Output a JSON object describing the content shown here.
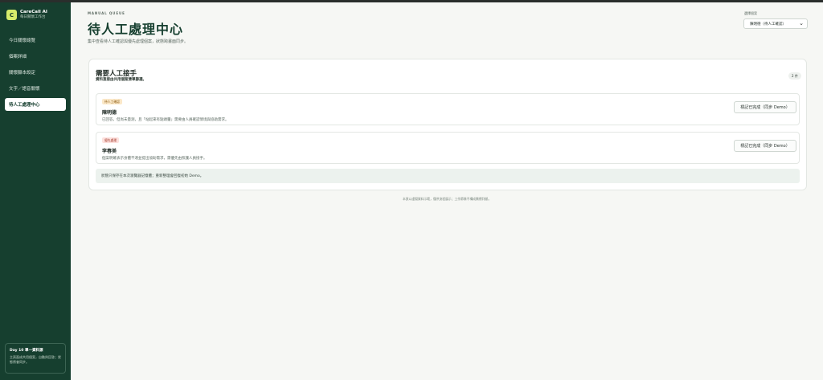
{
  "brand": {
    "logo_letter": "C",
    "name": "CareCall AI",
    "subtitle": "每日關懷工作台"
  },
  "sidebar": {
    "items": [
      {
        "label": "今日關懷總覽",
        "active": false
      },
      {
        "label": "個案詳細",
        "active": false
      },
      {
        "label": "關懷腳本設定",
        "active": false
      },
      {
        "label": "文字／語音關懷",
        "active": false
      },
      {
        "label": "待人工處理中心",
        "active": true
      }
    ],
    "day_card": {
      "title": "Day 10 單一資料源",
      "body": "主頁面成共用個案，自動與回答；狀態將會同步。"
    }
  },
  "header": {
    "eyebrow": "MANUAL QUEUE",
    "title": "待人工處理中心",
    "description": "集中查看待人工確認與優先處理個案，狀態跨畫面同步。"
  },
  "caregiver": {
    "label": "選擇個案",
    "selected": "陳明德（待人工確認）"
  },
  "panel": {
    "title": "需要人工接手",
    "subtitle": "資料直接由共用個案清單篩選。",
    "count": "2 件",
    "cases": [
      {
        "tag": "待人工確認",
        "tag_type": "manual",
        "name": "陳明德",
        "description": "已回答，但尚未量測，且「站起來有點頭暈」需要由人員確認情境與協助需求。",
        "button": "標記已完成（同步 Demo）"
      },
      {
        "tag": "優先處理",
        "tag_type": "priority",
        "name": "李春美",
        "description": "個案明確表示身體不適並提出協助需求，需優先由照護人員接手。",
        "button": "標記已完成（同步 Demo）"
      }
    ],
    "notice": "狀態只保存在本次瀏覽器記憶體；重新整理會回復初始 Demo。"
  },
  "footer": "本頁以虛擬資料示範，僅供流程展示；工作節奏不構成醫療判斷。",
  "colors": {
    "sidebar_bg": "#163f2f",
    "accent": "#d6ec6b",
    "title": "#163f2f"
  }
}
